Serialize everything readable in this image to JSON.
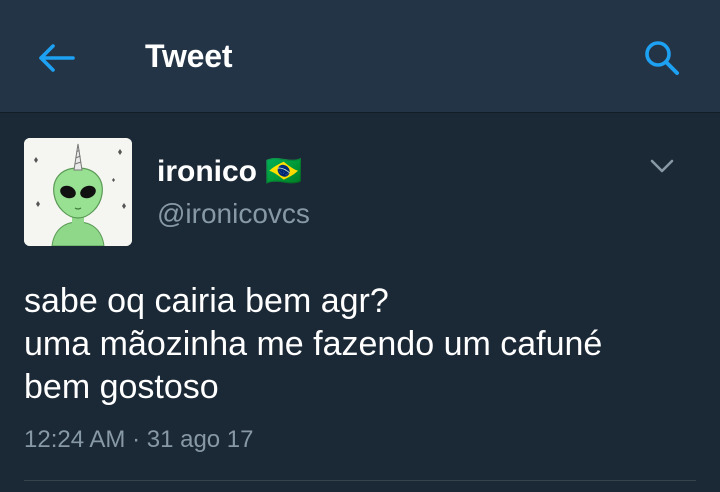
{
  "app_bar": {
    "title": "Tweet",
    "back_icon": "arrow-left-icon",
    "search_icon": "search-icon",
    "accent_color": "#1da1f2"
  },
  "tweet": {
    "author": {
      "display_name": "ironico",
      "name_emoji": "🇧🇷",
      "handle": "@ironicovcs"
    },
    "text_lines": [
      "sabe oq cairia bem agr?",
      "uma mãozinha me fazendo um cafuné",
      "bem gostoso"
    ],
    "timestamp": "12:24 AM · 31 ago 17",
    "menu_icon": "chevron-down-icon"
  },
  "colors": {
    "background": "#1b2836",
    "header": "#243447",
    "secondary_text": "#8899a6"
  }
}
